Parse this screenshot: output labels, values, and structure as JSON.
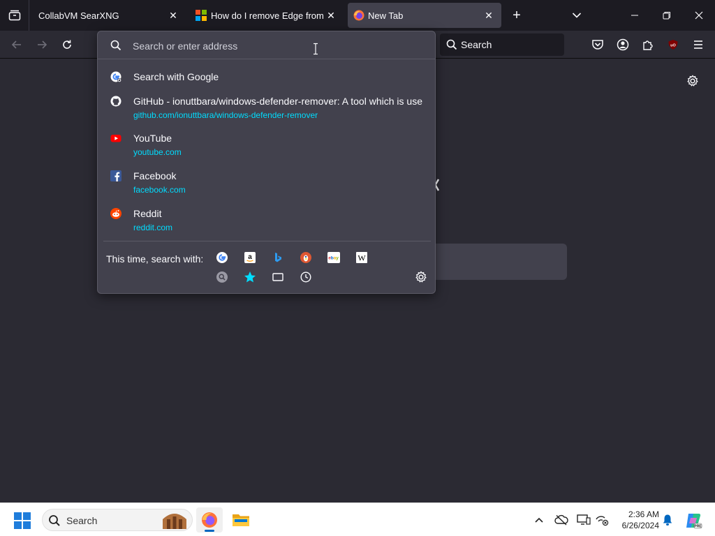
{
  "browser": {
    "tabs": [
      {
        "title": "CollabVM SearXNG",
        "active": false
      },
      {
        "title": "How do I remove Edge from my",
        "active": false
      },
      {
        "title": "New Tab",
        "active": true
      }
    ],
    "new_tab_symbol": "+",
    "close_symbol": "✕"
  },
  "navbar": {
    "search_placeholder": "Search"
  },
  "urlbar": {
    "placeholder": "Search or enter address",
    "results": [
      {
        "icon": "google-icon",
        "title": "Search with Google",
        "url": ""
      },
      {
        "icon": "github-icon",
        "title": "GitHub - ionuttbara/windows-defender-remover: A tool which is use",
        "url": "github.com/ionuttbara/windows-defender-remover"
      },
      {
        "icon": "youtube-icon",
        "title": "YouTube",
        "url": "youtube.com"
      },
      {
        "icon": "facebook-icon",
        "title": "Facebook",
        "url": "facebook.com"
      },
      {
        "icon": "reddit-icon",
        "title": "Reddit",
        "url": "reddit.com"
      }
    ],
    "one_off_label": "This time, search with:",
    "engines": [
      "google-icon",
      "amazon-icon",
      "bing-icon",
      "duckduckgo-icon",
      "ebay-icon",
      "wikipedia-icon"
    ],
    "modes": [
      "searxng-icon",
      "bookmarks-star-icon",
      "tabs-icon",
      "history-clock-icon"
    ]
  },
  "taskbar": {
    "search_label": "Search",
    "time": "2:36 AM",
    "date": "6/26/2024"
  },
  "colors": {
    "accent_link": "#00ddff",
    "panel_bg": "#42414d",
    "chrome_bg": "#1c1b22",
    "toolbar_bg": "#2b2a33",
    "windows_blue": "#1f7ddb"
  }
}
